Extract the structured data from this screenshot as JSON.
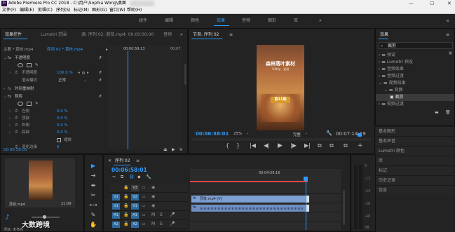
{
  "titlebar": {
    "app_icon": "Pr",
    "title": "Adobe Premiere Pro CC 2018 - C:\\用户\\Sophia Wong\\桌面",
    "minimize": "—",
    "maximize": "☐",
    "close": "✕"
  },
  "menu": [
    "文件(F)",
    "编辑(E)",
    "剪辑(C)",
    "序列(S)",
    "标记(M)",
    "图形(G)",
    "窗口(W)",
    "帮助(H)"
  ],
  "workspaces": {
    "items": [
      "组件",
      "编辑",
      "颜色",
      "效果",
      "音频",
      "图形",
      "库"
    ],
    "active_index": 3,
    "more": "»",
    "menu": "≡"
  },
  "effect_controls": {
    "tabs": [
      "效果控件",
      "Lumetri 范围",
      "源: 序列 02: 荔枝.mp4: 00:00:00:00",
      "音频"
    ],
    "more": "»",
    "master_label": "主要 * 荔枝.mp4",
    "sequence_label": "序列 02 * 荔枝.mp4",
    "ruler_timecode": "00:00:59:13",
    "ruler_end": "00:07",
    "sections": {
      "opacity": "不透明度",
      "time_remap": "时间重映射",
      "crop": "裁剪"
    },
    "opacity": {
      "label": "不透明度",
      "value": "100.0 %"
    },
    "blend": {
      "label": "混合模式",
      "value": "正常"
    },
    "crop_params": [
      {
        "label": "左侧",
        "value": "0.0 %"
      },
      {
        "label": "顶部",
        "value": "0.0 %"
      },
      {
        "label": "右侧",
        "value": "0.0 %"
      },
      {
        "label": "底部",
        "value": "0.0 %"
      }
    ],
    "zoom": {
      "label": "缩放",
      "checked": false
    },
    "feather": {
      "label": "羽化边缘",
      "value": "0"
    },
    "timecode": "00:06:58:05"
  },
  "program_monitor": {
    "tab": "节目: 序列 02",
    "menu": "≡",
    "poster_title": "森林落叶素材",
    "poster_subtitle": "1080p · 竖屏",
    "poster_badge": "第11期",
    "timecode": "00:06:58:01",
    "zoom": "25%",
    "quality": "完整",
    "duration": "00:07:14:19",
    "transport": [
      "{",
      "}",
      "|◀",
      "◀|",
      "▶",
      "|▶",
      "▶|",
      "⧉",
      "⧉",
      "⧉"
    ],
    "add": "+"
  },
  "effects_panel": {
    "tab": "效果",
    "menu": "≡",
    "search_value": "裁剪",
    "tree": [
      {
        "label": "预设",
        "level": 0
      },
      {
        "label": "Lumetri 预设",
        "level": 0
      },
      {
        "label": "音频效果",
        "level": 0
      },
      {
        "label": "音频过渡",
        "level": 0
      },
      {
        "label": "视频效果",
        "level": 0
      },
      {
        "label": "变换",
        "level": 1
      },
      {
        "label": "裁剪",
        "level": 2
      },
      {
        "label": "视频过渡",
        "level": 0
      }
    ],
    "links": [
      "基本图形",
      "基本声音",
      "Lumetri 颜色",
      "库",
      "标记",
      "历史记录",
      "信息"
    ]
  },
  "project_panel": {
    "clip_name": "荔枝.mp4",
    "clip_duration": "21:09",
    "watermark": "大数跨境",
    "footer": "项目: 未命名"
  },
  "tools": [
    "▶",
    "⇥",
    "⇼",
    "✂",
    "⟷",
    "✎",
    "✋",
    "T"
  ],
  "timeline": {
    "tab": "序列 02",
    "menu": "≡",
    "timecode": "00:06:58:01",
    "ruler_timecode": "00:04:59:16",
    "video_tracks": [
      {
        "src": "",
        "name": "V3"
      },
      {
        "src": "V1",
        "name": "V2"
      },
      {
        "src": "V1",
        "name": "V1"
      }
    ],
    "audio_tracks": [
      {
        "src": "A1",
        "name": "A1"
      },
      {
        "src": "A2",
        "name": "A2"
      }
    ],
    "video_clip": "荔枝.mp4 [V]",
    "toggles": [
      "M",
      "S"
    ],
    "mute": "🎤"
  },
  "audio_meter": {
    "ticks": [
      "0",
      "-12",
      "-24",
      "-36",
      "-48",
      "dB"
    ]
  },
  "colors": {
    "accent": "#2f9bff",
    "panel": "#232323",
    "clip_video": "#7d9fd4",
    "clip_audio": "#6f8fc2",
    "work_bar": "#e04848"
  }
}
